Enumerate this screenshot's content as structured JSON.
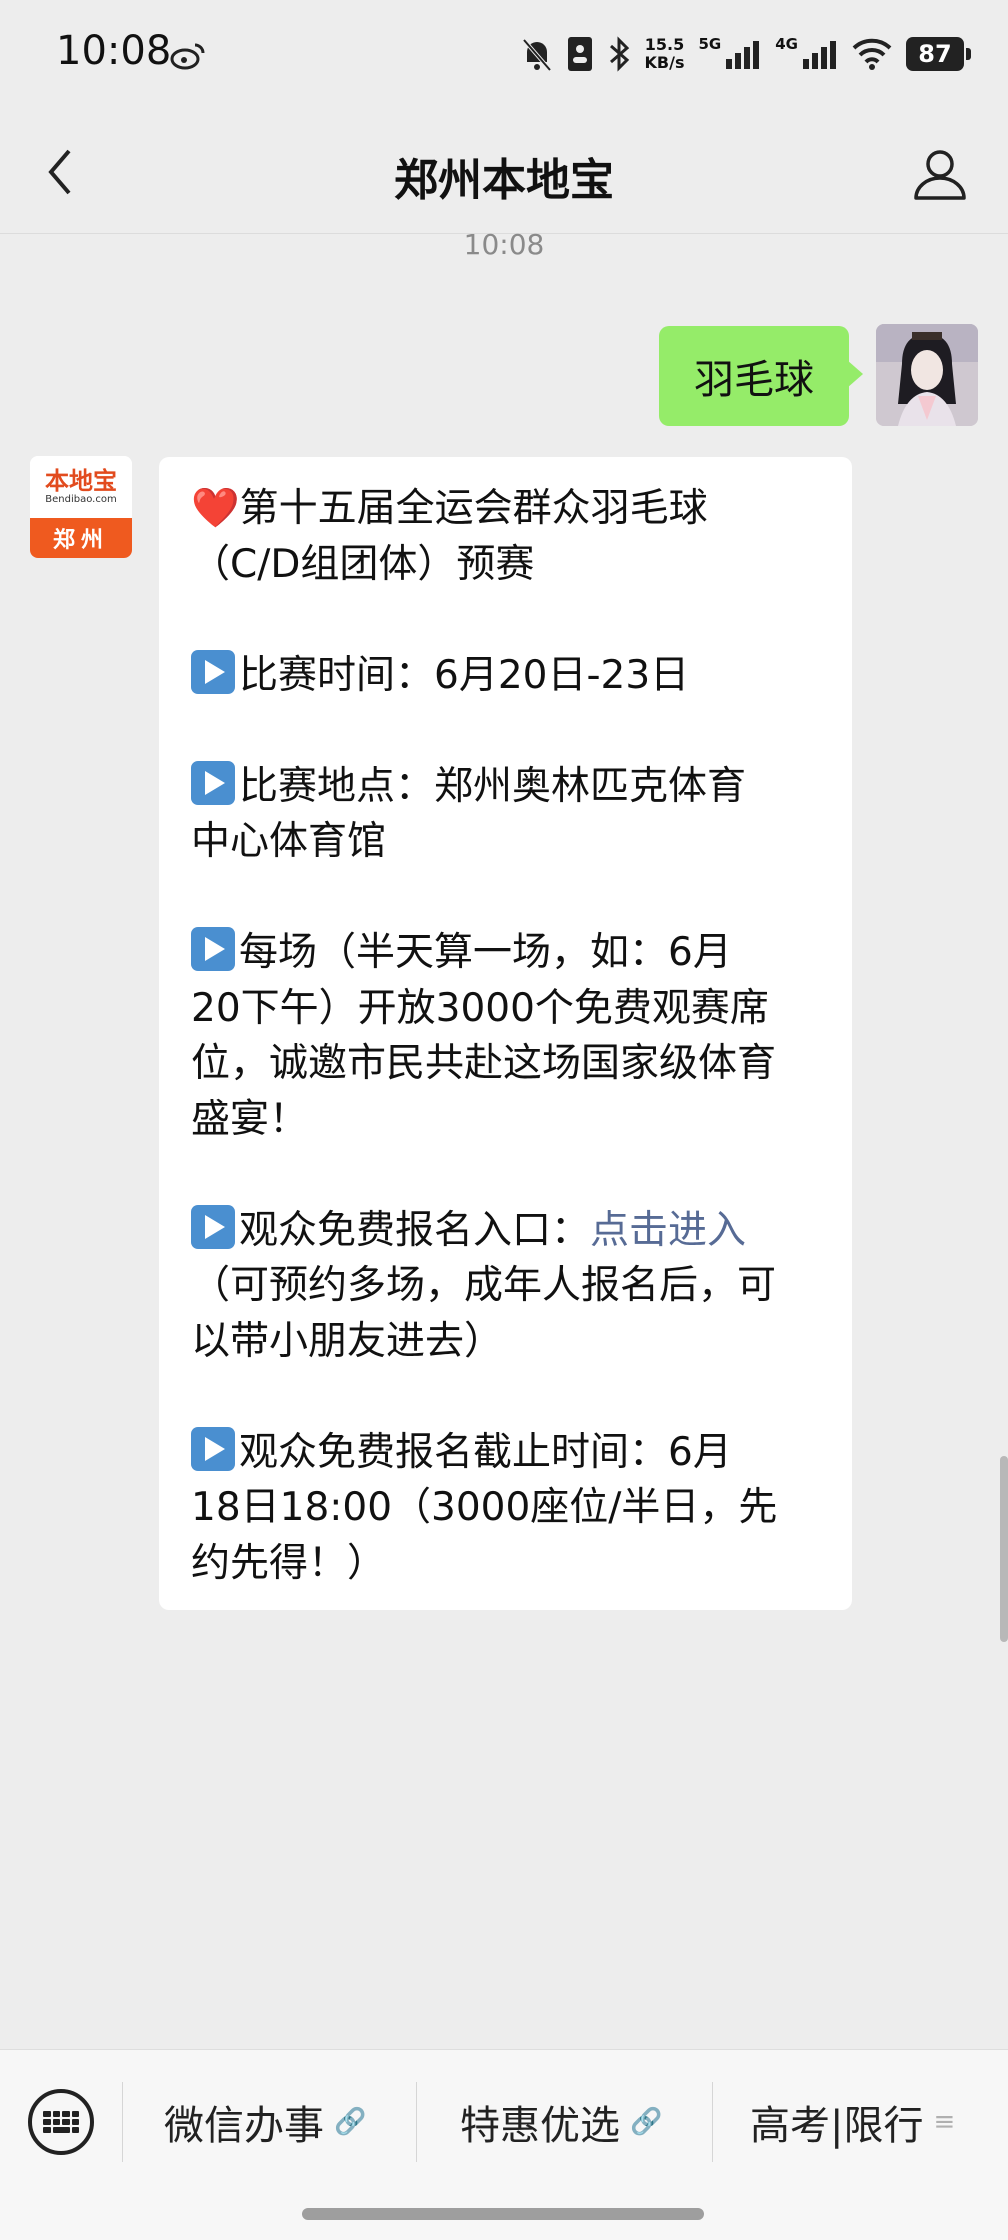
{
  "status_bar": {
    "time": "10:08",
    "network_speed_value": "15.5",
    "network_speed_unit": "KB/s",
    "net_label_1": "5G",
    "net_label_2": "4G",
    "battery": "87"
  },
  "header": {
    "title": "郑州本地宝"
  },
  "chat": {
    "timestamp": "10:08",
    "sent_message": "羽毛球",
    "bot_avatar": {
      "brand": "本地宝",
      "domain": "Bendibao.com",
      "city": "郑州"
    },
    "received_lines": [
      "第十五届全运会群众羽毛球",
      "（C/D组团体）预赛",
      "比赛时间：6月20日-23日",
      "比赛地点：郑州奥林匹克体育",
      "中心体育馆",
      "每场（半天算一场，如：6月",
      "20下午）开放3000个免费观赛席",
      "位，诚邀市民共赴这场国家级体育",
      "盛宴！",
      "观众免费报名入口：",
      "点击进入",
      "（可预约多场，成年人报名后，可",
      "以带小朋友进去）",
      "观众免费报名截止时间：6月",
      "18日18:00（3000座位/半日，先",
      "约先得！）"
    ],
    "heart_emoji": "❤️"
  },
  "bottom_menu": {
    "items": [
      {
        "label": "微信办事",
        "glyph": "🔗"
      },
      {
        "label": "特惠优选",
        "glyph": "🔗"
      },
      {
        "label": "高考|限行",
        "glyph": "≡"
      }
    ]
  },
  "colors": {
    "sent_bubble": "#95ec69",
    "link": "#576b95",
    "play_icon": "#4a8fd0",
    "brand_orange": "#ef5a1f"
  }
}
